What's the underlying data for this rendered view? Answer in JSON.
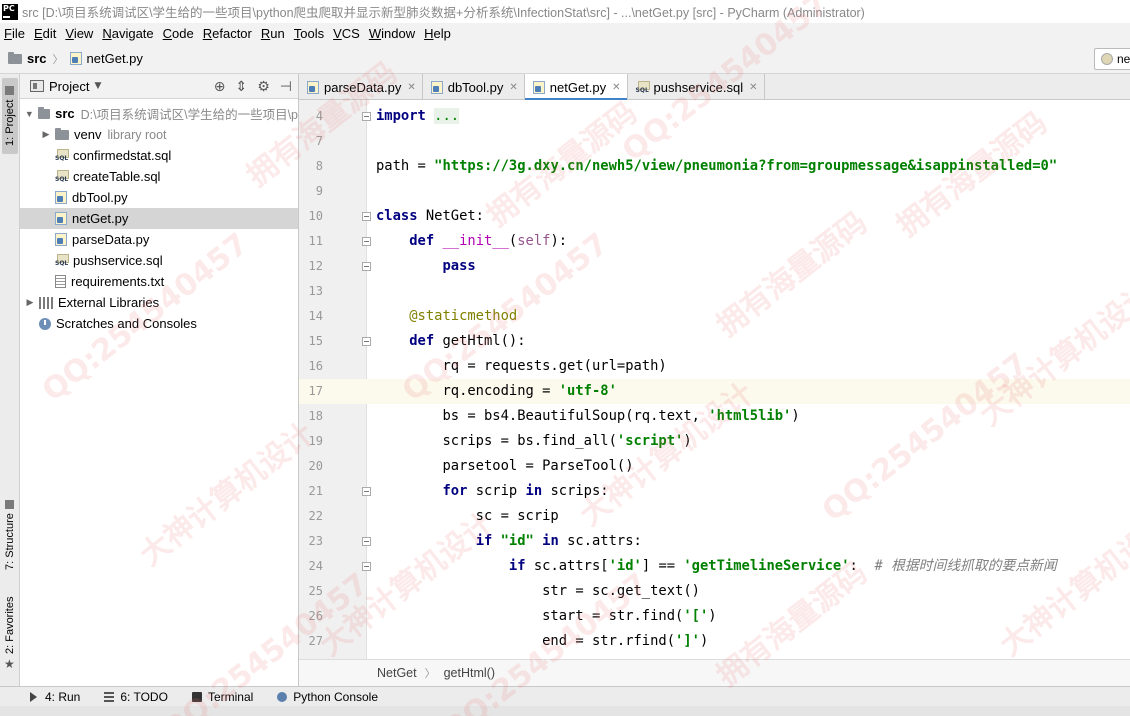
{
  "window": {
    "title": "src [D:\\项目系统调试区\\学生给的一些项目\\python爬虫爬取并显示新型肺炎数据+分析系统\\InfectionStat\\src] - ...\\netGet.py [src] - PyCharm (Administrator)",
    "logo": "PC"
  },
  "menu": [
    "File",
    "Edit",
    "View",
    "Navigate",
    "Code",
    "Refactor",
    "Run",
    "Tools",
    "VCS",
    "Window",
    "Help"
  ],
  "navbar": {
    "crumb_root": "src",
    "crumb_file": "netGet.py",
    "right_tab": "netGet"
  },
  "left_stripe": {
    "project": "1: Project",
    "structure": "7: Structure",
    "favorites": "2: Favorites"
  },
  "project_panel": {
    "title": "Project",
    "tree": [
      {
        "label": "src",
        "note": "D:\\项目系统调试区\\学生给的一些项目\\p",
        "icon": "folder-icon",
        "depth": 0,
        "arrow": "expanded"
      },
      {
        "label": "venv",
        "note": "library root",
        "icon": "folder-icon",
        "depth": 1,
        "arrow": "collapsed"
      },
      {
        "label": "confirmedstat.sql",
        "note": "",
        "icon": "sql-file-icon",
        "depth": 1,
        "arrow": ""
      },
      {
        "label": "createTable.sql",
        "note": "",
        "icon": "sql-file-icon",
        "depth": 1,
        "arrow": ""
      },
      {
        "label": "dbTool.py",
        "note": "",
        "icon": "python-file-icon",
        "depth": 1,
        "arrow": ""
      },
      {
        "label": "netGet.py",
        "note": "",
        "icon": "python-file-icon",
        "depth": 1,
        "arrow": "",
        "selected": true
      },
      {
        "label": "parseData.py",
        "note": "",
        "icon": "python-file-icon",
        "depth": 1,
        "arrow": ""
      },
      {
        "label": "pushservice.sql",
        "note": "",
        "icon": "sql-file-icon",
        "depth": 1,
        "arrow": ""
      },
      {
        "label": "requirements.txt",
        "note": "",
        "icon": "text-file-icon",
        "depth": 1,
        "arrow": ""
      },
      {
        "label": "External Libraries",
        "note": "",
        "icon": "library-icon",
        "depth": 0,
        "arrow": "collapsed"
      },
      {
        "label": "Scratches and Consoles",
        "note": "",
        "icon": "scratch-icon",
        "depth": 0,
        "arrow": ""
      }
    ]
  },
  "tabs": [
    {
      "label": "parseData.py",
      "icon": "python-file-icon",
      "active": false
    },
    {
      "label": "dbTool.py",
      "icon": "python-file-icon",
      "active": false
    },
    {
      "label": "netGet.py",
      "icon": "python-file-icon",
      "active": true
    },
    {
      "label": "pushservice.sql",
      "icon": "sql-file-icon",
      "active": false
    }
  ],
  "editor": {
    "current_line": "17",
    "lines": [
      {
        "n": "4",
        "tokens": [
          [
            "kw",
            "import "
          ],
          [
            "fold-str",
            "..."
          ]
        ],
        "fold": true
      },
      {
        "n": "7",
        "tokens": []
      },
      {
        "n": "8",
        "tokens": [
          [
            "",
            "path = "
          ],
          [
            "str",
            "\"https://3g.dxy.cn/newh5/view/pneumonia?from=groupmessage&isappinstalled=0\""
          ]
        ]
      },
      {
        "n": "9",
        "tokens": []
      },
      {
        "n": "10",
        "tokens": [
          [
            "kw",
            "class "
          ],
          [
            "",
            "NetGet:"
          ]
        ],
        "fold": true
      },
      {
        "n": "11",
        "tokens": [
          [
            "",
            "    "
          ],
          [
            "kw",
            "def "
          ],
          [
            "dunder",
            "__init__"
          ],
          [
            "",
            "("
          ],
          [
            "self",
            "self"
          ],
          [
            "",
            "):"
          ]
        ],
        "fold": true
      },
      {
        "n": "12",
        "tokens": [
          [
            "",
            "        "
          ],
          [
            "kw",
            "pass"
          ]
        ],
        "fold": true
      },
      {
        "n": "13",
        "tokens": []
      },
      {
        "n": "14",
        "tokens": [
          [
            "",
            "    "
          ],
          [
            "dec",
            "@staticmethod"
          ]
        ]
      },
      {
        "n": "15",
        "tokens": [
          [
            "",
            "    "
          ],
          [
            "kw",
            "def "
          ],
          [
            "",
            "getHtml():"
          ]
        ],
        "fold": true
      },
      {
        "n": "16",
        "tokens": [
          [
            "",
            "        rq = requests.get(url=path)"
          ]
        ]
      },
      {
        "n": "17",
        "tokens": [
          [
            "",
            "        rq.encoding = "
          ],
          [
            "str",
            "'utf-8'"
          ]
        ]
      },
      {
        "n": "18",
        "tokens": [
          [
            "",
            "        bs = bs4.BeautifulSoup(rq.text, "
          ],
          [
            "str",
            "'html5lib'"
          ],
          [
            "",
            ")"
          ]
        ]
      },
      {
        "n": "19",
        "tokens": [
          [
            "",
            "        scrips = bs.find_all("
          ],
          [
            "str",
            "'script'"
          ],
          [
            "",
            ")"
          ]
        ]
      },
      {
        "n": "20",
        "tokens": [
          [
            "",
            "        parsetool = ParseTool()"
          ]
        ]
      },
      {
        "n": "21",
        "tokens": [
          [
            "",
            "        "
          ],
          [
            "kw",
            "for "
          ],
          [
            "",
            "scrip "
          ],
          [
            "kw",
            "in "
          ],
          [
            "",
            "scrips:"
          ]
        ],
        "fold": true
      },
      {
        "n": "22",
        "tokens": [
          [
            "",
            "            sc = scrip"
          ]
        ]
      },
      {
        "n": "23",
        "tokens": [
          [
            "",
            "            "
          ],
          [
            "kw",
            "if "
          ],
          [
            "str",
            "\"id\" "
          ],
          [
            "kw",
            "in "
          ],
          [
            "",
            "sc.attrs:"
          ]
        ],
        "fold": true
      },
      {
        "n": "24",
        "tokens": [
          [
            "",
            "                "
          ],
          [
            "kw",
            "if "
          ],
          [
            "",
            "sc.attrs["
          ],
          [
            "str",
            "'id'"
          ],
          [
            "",
            "] == "
          ],
          [
            "str",
            "'getTimelineService'"
          ],
          [
            "",
            ":  "
          ],
          [
            "cmt",
            "# 根据时间线抓取的要点新闻"
          ]
        ],
        "fold": true
      },
      {
        "n": "25",
        "tokens": [
          [
            "",
            "                    str = sc.get_text()"
          ]
        ]
      },
      {
        "n": "26",
        "tokens": [
          [
            "",
            "                    start = str.find("
          ],
          [
            "str",
            "'['"
          ],
          [
            "",
            ")"
          ]
        ]
      },
      {
        "n": "27",
        "tokens": [
          [
            "",
            "                    end = str.rfind("
          ],
          [
            "str",
            "']'"
          ],
          [
            "",
            ")"
          ]
        ]
      }
    ]
  },
  "breadcrumb": [
    "NetGet",
    "getHtml()"
  ],
  "tool_windows": [
    {
      "label": "4: Run",
      "icon": "run-icon"
    },
    {
      "label": "6: TODO",
      "icon": "todo-icon"
    },
    {
      "label": "Terminal",
      "icon": "terminal-icon"
    },
    {
      "label": "Python Console",
      "icon": "python-console-icon"
    }
  ],
  "watermarks": [
    "QQ:254540457",
    "拥有海量源码",
    "大神计算机设计"
  ]
}
